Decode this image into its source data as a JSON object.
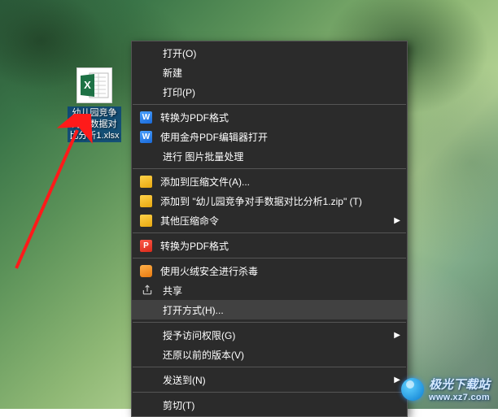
{
  "desktop": {
    "file": {
      "label": "幼儿园竞争对手数据对比分析1.xlsx",
      "icon": "excel-file-icon"
    }
  },
  "context_menu": {
    "items": [
      {
        "label": "打开(O)",
        "icon": "",
        "submenu": false
      },
      {
        "label": "新建",
        "icon": "",
        "submenu": false
      },
      {
        "label": "打印(P)",
        "icon": "",
        "submenu": false
      },
      {
        "sep": true
      },
      {
        "label": "转换为PDF格式",
        "icon": "pdf-blue-icon",
        "submenu": false
      },
      {
        "label": "使用金舟PDF编辑器打开",
        "icon": "pdf-blue-icon",
        "submenu": false
      },
      {
        "label": "进行 图片批量处理",
        "icon": "",
        "submenu": false
      },
      {
        "sep": true
      },
      {
        "label": "添加到压缩文件(A)...",
        "icon": "archive-icon",
        "submenu": false
      },
      {
        "label": "添加到 \"幼儿园竞争对手数据对比分析1.zip\" (T)",
        "icon": "archive-icon",
        "submenu": false
      },
      {
        "label": "其他压缩命令",
        "icon": "archive-icon",
        "submenu": true
      },
      {
        "sep": true
      },
      {
        "label": "转换为PDF格式",
        "icon": "pdf-red-icon",
        "submenu": false
      },
      {
        "sep": true
      },
      {
        "label": "使用火绒安全进行杀毒",
        "icon": "huorong-icon",
        "submenu": false
      },
      {
        "label": "共享",
        "icon": "share-icon",
        "submenu": false
      },
      {
        "label": "打开方式(H)...",
        "icon": "",
        "submenu": false,
        "highlighted": true
      },
      {
        "sep": true
      },
      {
        "label": "授予访问权限(G)",
        "icon": "",
        "submenu": true
      },
      {
        "label": "还原以前的版本(V)",
        "icon": "",
        "submenu": false
      },
      {
        "sep": true
      },
      {
        "label": "发送到(N)",
        "icon": "",
        "submenu": true
      },
      {
        "sep": true
      },
      {
        "label": "剪切(T)",
        "icon": "",
        "submenu": false
      }
    ]
  },
  "watermark": {
    "text": "极光下载站",
    "url": "www.xz7.com"
  }
}
